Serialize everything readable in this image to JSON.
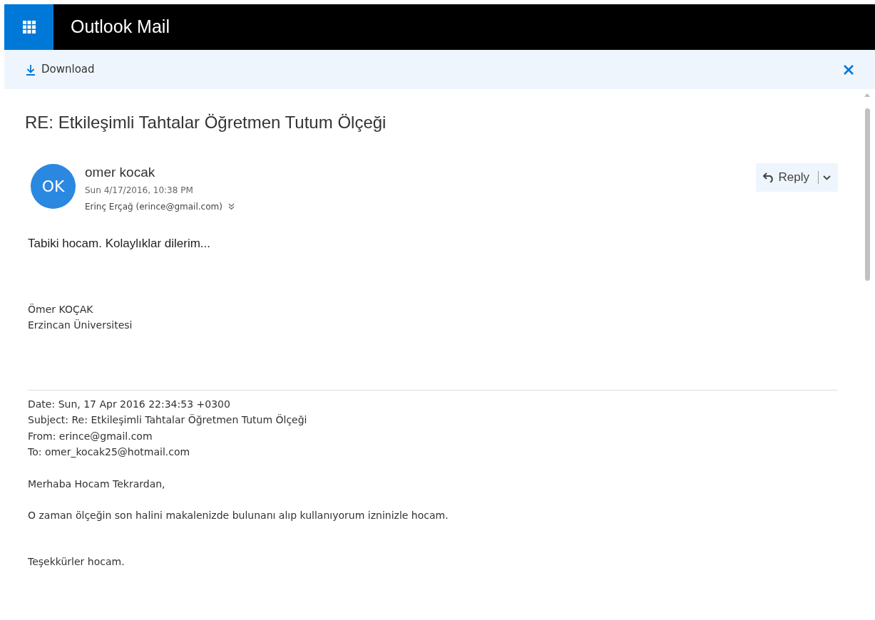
{
  "app": {
    "title": "Outlook Mail"
  },
  "toolbar": {
    "download": "Download"
  },
  "message": {
    "subject": "RE: Etkileşimli Tahtalar Öğretmen Tutum Ölçeği",
    "avatar": "OK",
    "sender": "omer kocak",
    "date": "Sun 4/17/2016, 10:38 PM",
    "recipient": "Erinç Erçağ (erince@gmail.com)",
    "reply": "Reply",
    "body": "Tabiki hocam. Kolaylıklar dilerim...",
    "signature": [
      "Ömer KOÇAK",
      "Erzincan Üniversitesi"
    ],
    "quoted_headers": [
      "Date: Sun, 17 Apr 2016 22:34:53 +0300",
      "Subject: Re: Etkileşimli Tahtalar Öğretmen Tutum Ölçeği",
      "From: erince@gmail.com",
      "To: omer_kocak25@hotmail.com"
    ],
    "quoted_paragraphs": [
      "Merhaba Hocam Tekrardan,",
      "O zaman ölçeğin son halini makalenizde bulunanı alıp kullanıyorum izninizle hocam.",
      "Teşekkürler hocam."
    ]
  }
}
